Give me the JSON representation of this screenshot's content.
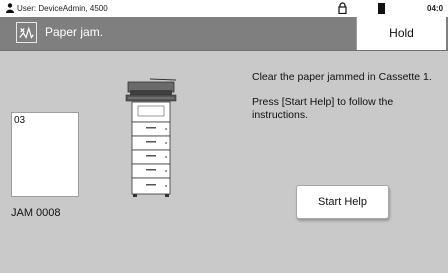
{
  "status_bar": {
    "user_label": "User: DeviceAdmin, 4500",
    "clock": "04:0",
    "icons": [
      "user-icon",
      "lock-icon",
      "battery-icon"
    ]
  },
  "header": {
    "title": "Paper jam.",
    "alert_icon": "paper-jam-icon",
    "hold_label": "Hold"
  },
  "jam_info": {
    "cassette_number": "03",
    "jam_code": "JAM 0008"
  },
  "message": {
    "line1": "Clear the paper jammed in Cassette 1.",
    "line2": "Press [Start Help] to follow the instructions."
  },
  "actions": {
    "start_help_label": "Start Help"
  },
  "colors": {
    "background": "#c9c9c9",
    "title_bar": "#7f7f7f",
    "panel": "#ffffff"
  }
}
